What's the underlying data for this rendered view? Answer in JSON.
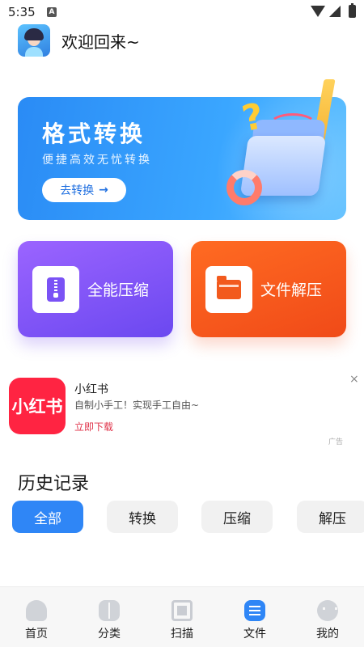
{
  "status_bar": {
    "time": "5:35",
    "notif_letter": "A"
  },
  "header": {
    "welcome": "欢迎回来~"
  },
  "banner": {
    "title": "格式转换",
    "subtitle": "便捷高效无忧转换",
    "button_label": "去转换",
    "button_arrow": "→"
  },
  "cards": [
    {
      "label": "全能压缩",
      "icon": "zip-file-icon",
      "color": "#7b55f6"
    },
    {
      "label": "文件解压",
      "icon": "folder-icon",
      "color": "#f35a1e"
    }
  ],
  "ad": {
    "logo_text": "小红书",
    "title": "小红书",
    "description": "自制小手工！实现手工自由~",
    "cta": "立即下载",
    "tag": "广告",
    "close": "×"
  },
  "history": {
    "title": "历史记录",
    "filters": [
      "全部",
      "转换",
      "压缩",
      "解压"
    ],
    "active_filter": "全部"
  },
  "tabbar": {
    "items": [
      {
        "label": "首页",
        "icon": "home-icon"
      },
      {
        "label": "分类",
        "icon": "category-icon"
      },
      {
        "label": "扫描",
        "icon": "scan-icon"
      },
      {
        "label": "文件",
        "icon": "file-icon"
      },
      {
        "label": "我的",
        "icon": "profile-icon"
      }
    ],
    "active": "文件"
  },
  "colors": {
    "accent": "#2f86f6",
    "compress": "#7b55f6",
    "extract": "#f35a1e",
    "ad_red": "#ff2442"
  }
}
